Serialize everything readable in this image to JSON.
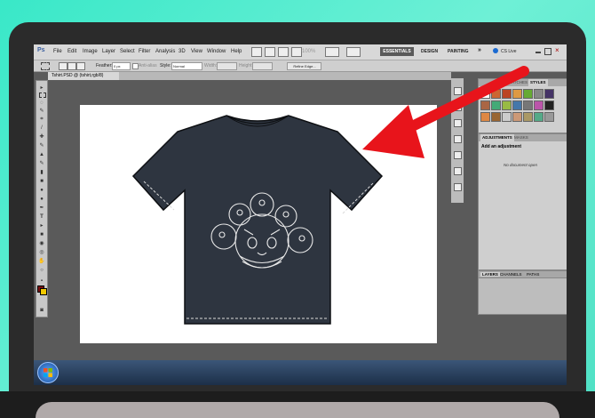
{
  "menubar": {
    "logo": "Ps",
    "items": [
      "File",
      "Edit",
      "Image",
      "Layer",
      "Select",
      "Filter",
      "Analysis",
      "3D",
      "View",
      "Window",
      "Help"
    ],
    "zoom": "100%",
    "workspaces": [
      "ESSENTIALS",
      "DESIGN",
      "PAINTING"
    ],
    "more": "»",
    "cs_live": "CS Live"
  },
  "options": {
    "feather_label": "Feather:",
    "feather_value": "0 px",
    "antialias_label": "Anti-alias",
    "style_label": "Style:",
    "style_value": "Normal",
    "width_label": "Width:",
    "height_label": "Height:",
    "refine_edge": "Refine Edge..."
  },
  "document": {
    "tab_title": "Tshirt.PSD @ (tshirt,rgb/8)"
  },
  "panels": {
    "swatches_tab": "SWATCHES",
    "styles_tab": "STYLES",
    "adjustments_tab": "ADJUSTMENTS",
    "masks_tab": "MASKS",
    "add_adjustment": "Add an adjustment",
    "no_document": "No document open",
    "layers_tab": "LAYERS",
    "channels_tab": "CHANNELS",
    "paths_tab": "PATHS"
  },
  "colors": {
    "arrow": "#e8141b",
    "shirt": "#2e3540",
    "foreground": "#7a1010",
    "background": "#f2c900"
  }
}
